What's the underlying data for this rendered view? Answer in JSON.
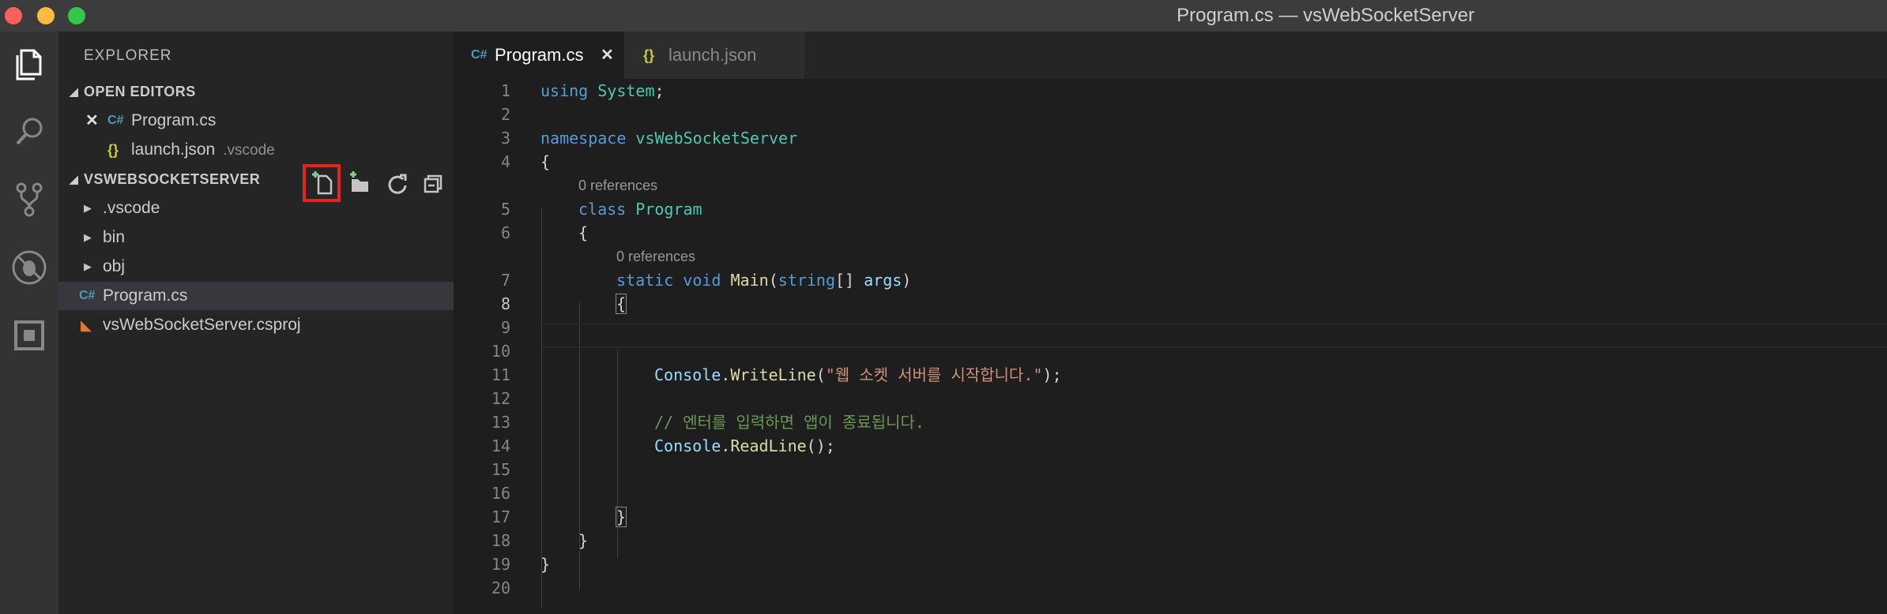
{
  "window": {
    "title": "Program.cs — vsWebSocketServer"
  },
  "sidebar": {
    "title": "EXPLORER",
    "open_editors": {
      "header": "OPEN EDITORS",
      "items": [
        {
          "name": "Program.cs",
          "desc": "",
          "icon": "csharp-icon"
        },
        {
          "name": "launch.json",
          "desc": ".vscode",
          "icon": "json-icon"
        }
      ]
    },
    "project": {
      "header": "VSWEBSOCKETSERVER",
      "items": [
        {
          "name": ".vscode",
          "type": "folder"
        },
        {
          "name": "bin",
          "type": "folder"
        },
        {
          "name": "obj",
          "type": "folder"
        },
        {
          "name": "Program.cs",
          "type": "file",
          "icon": "csharp-icon"
        },
        {
          "name": "vsWebSocketServer.csproj",
          "type": "file",
          "icon": "rss-icon"
        }
      ]
    }
  },
  "tabs": [
    {
      "label": "Program.cs",
      "icon_text": "C#",
      "active": true
    },
    {
      "label": "launch.json",
      "icon_text": "{}",
      "active": false
    }
  ],
  "icons": {
    "cs": "C#",
    "json": "{}",
    "close": "✕",
    "rss": "◣"
  },
  "editor": {
    "current_line": 8,
    "codelens": "0 references",
    "lines": [
      "1",
      "2",
      "3",
      "4",
      "5",
      "6",
      "7",
      "8",
      "9",
      "10",
      "11",
      "12",
      "13",
      "14",
      "15",
      "16",
      "17",
      "18",
      "19",
      "20"
    ],
    "code": {
      "l1": [
        "using",
        "System",
        ";"
      ],
      "l3": [
        "namespace",
        "vsWebSocketServer"
      ],
      "l4": "{",
      "l5": [
        "class",
        "Program"
      ],
      "l6": "{",
      "l7": [
        "static",
        "void",
        "Main",
        "(",
        "string",
        "[] ",
        "args",
        ")"
      ],
      "l8": "{",
      "l11": [
        "Console",
        ".",
        "WriteLine",
        "(",
        "\"웹 소켓 서버를 시작합니다.\"",
        ");"
      ],
      "l13": "// 엔터를 입력하면 앱이 종료됩니다.",
      "l14": [
        "Console",
        ".",
        "ReadLine",
        "();"
      ],
      "l17": "}",
      "l18": "}",
      "l19": "}"
    }
  },
  "colors": {
    "highlight": "#e3251d",
    "keyword": "#569cd6",
    "type": "#4ec9b0",
    "string": "#ce9178",
    "comment": "#6a9955"
  }
}
